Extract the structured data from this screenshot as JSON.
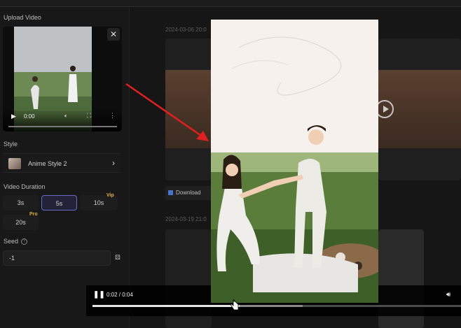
{
  "sidebar": {
    "upload_label": "Upload Video",
    "mini_player": {
      "time": "0:00"
    },
    "style_label": "Style",
    "style_value": "Anime Style 2",
    "duration_label": "Video Duration",
    "durations": [
      {
        "label": "3s",
        "tag": ""
      },
      {
        "label": "5s",
        "tag": ""
      },
      {
        "label": "10s",
        "tag": "Vip"
      },
      {
        "label": "20s",
        "tag": "Pro"
      }
    ],
    "selected_duration": "5s",
    "seed_label": "Seed",
    "seed_value": "-1"
  },
  "history": {
    "dates": [
      "2024-03-06 20:0",
      "2024-03-19 21:0"
    ],
    "download_label": "Download"
  },
  "player": {
    "time": "0:02 / 0:04",
    "progress": 0.4,
    "buffered": 0.57
  },
  "icons": [
    "close-icon",
    "play-icon",
    "volume-icon",
    "fullscreen-icon",
    "more-icon",
    "chevron-right-icon",
    "help-icon",
    "dice-icon",
    "pause-icon",
    "arrow-annotation"
  ],
  "colors": {
    "accent": "#6a67c9",
    "tag_gold": "#e0b040",
    "arrow": "#e02020"
  }
}
